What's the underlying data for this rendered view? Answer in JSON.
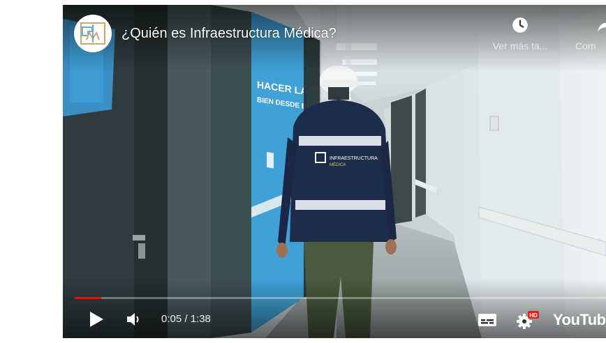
{
  "video": {
    "title": "¿Quién es Infraestructura Médica?",
    "channel_logo_text": "IM",
    "jacket_logo_text": "INFRAESTRUCTURA\nMÉDICA",
    "wall_text": "HACER LAS COSAS\nBIEN DESDE EL COMIENZO"
  },
  "top_actions": {
    "watch_later_label": "Ver más ta...",
    "watch_later_icon": "clock-icon",
    "share_label": "Com",
    "share_icon": "share-arrow-icon"
  },
  "controls": {
    "current_time": "0:05",
    "duration": "1:38",
    "time_text": "0:05 / 1:38",
    "progress_fraction": 0.05,
    "play_icon": "play-icon",
    "volume_icon": "volume-icon",
    "subtitles_icon": "subtitles-icon",
    "settings_icon": "gear-icon",
    "hd_badge": "HD",
    "brand": "YouTube"
  },
  "colors": {
    "progress": "#ff0000",
    "hd_badge": "#e62117",
    "wall_accent": "#3fa1d6"
  }
}
